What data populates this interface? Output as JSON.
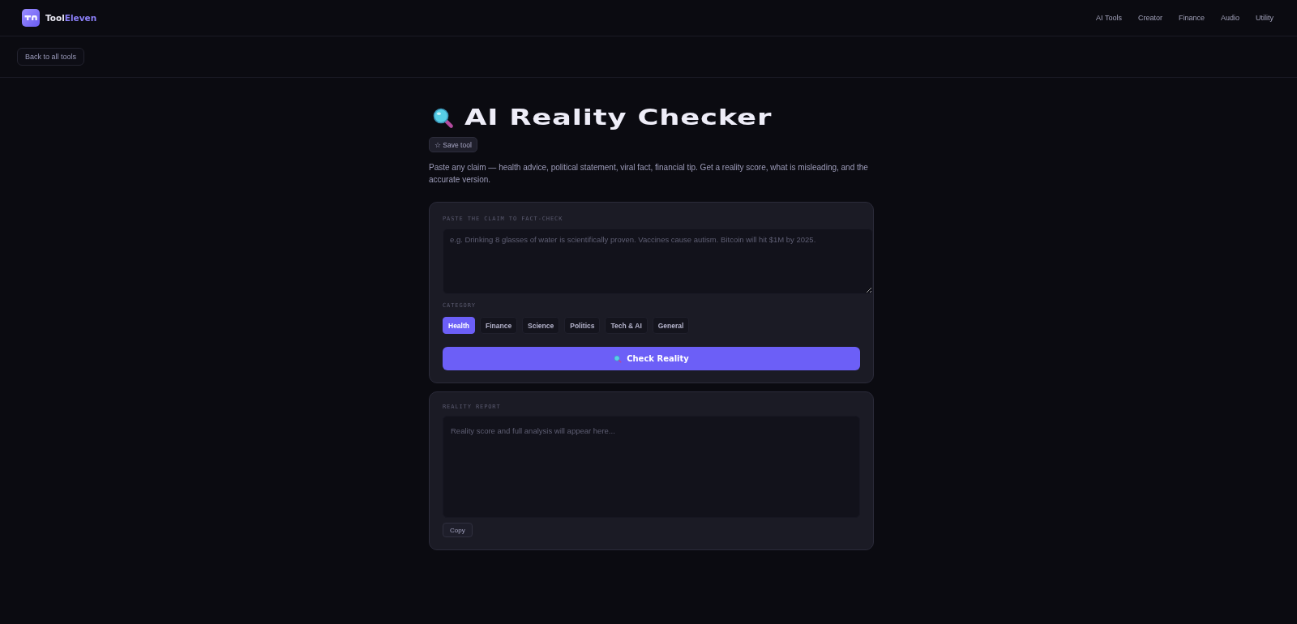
{
  "header": {
    "brand": {
      "text": "Tool",
      "accent_text": "Eleven"
    },
    "nav": [
      "AI Tools",
      "Creator",
      "Finance",
      "Audio",
      "Utility"
    ]
  },
  "back_button": "Back to all tools",
  "tool": {
    "title": "AI Reality Checker",
    "save_button": "☆ Save tool",
    "description": "Paste any claim — health advice, political statement, viral fact, financial tip. Get a reality score, what is misleading, and the accurate version."
  },
  "input_card": {
    "label": "PASTE THE CLAIM TO FACT-CHECK",
    "placeholder": "e.g. Drinking 8 glasses of water is scientifically proven. Vaccines cause autism. Bitcoin will hit $1M by 2025.",
    "category_label": "CATEGORY",
    "categories": [
      {
        "label": "Health",
        "selected": true
      },
      {
        "label": "Finance",
        "selected": false
      },
      {
        "label": "Science",
        "selected": false
      },
      {
        "label": "Politics",
        "selected": false
      },
      {
        "label": "Tech & AI",
        "selected": false
      },
      {
        "label": "General",
        "selected": false
      }
    ],
    "submit_button": "Check Reality"
  },
  "report_card": {
    "label": "REALITY REPORT",
    "placeholder": "Reality score and full analysis will appear here...",
    "copy_button": "Copy"
  }
}
